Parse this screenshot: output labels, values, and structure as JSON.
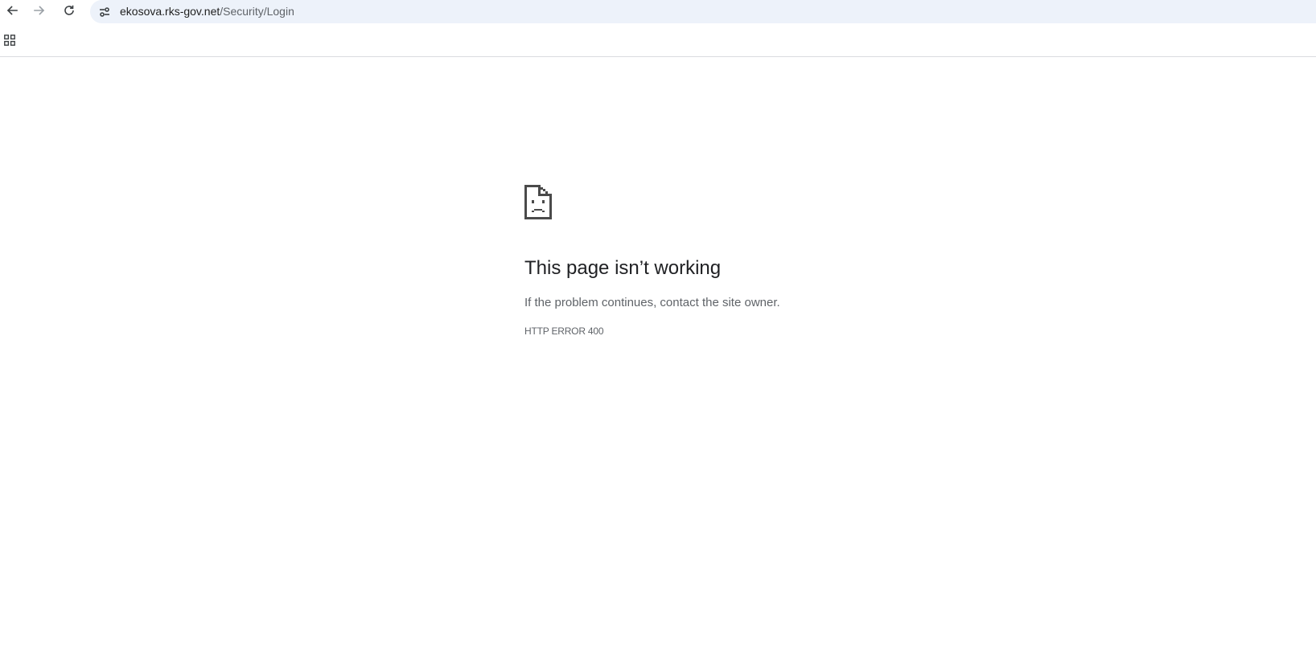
{
  "browser": {
    "address_host": "ekosova.rks-gov.net",
    "address_path": "/Security/Login",
    "icons": {
      "back": "back-arrow-icon",
      "forward": "forward-arrow-icon",
      "reload": "reload-icon",
      "site_info": "tune-icon",
      "apps": "apps-grid-icon"
    }
  },
  "error": {
    "icon": "sad-page-icon",
    "headline": "This page isn’t working",
    "message": "If the problem continues, contact the site owner.",
    "code": "HTTP ERROR 400"
  },
  "colors": {
    "omnibox_bg": "#edf2fa",
    "text_primary": "#202124",
    "text_secondary": "#5f6368"
  }
}
